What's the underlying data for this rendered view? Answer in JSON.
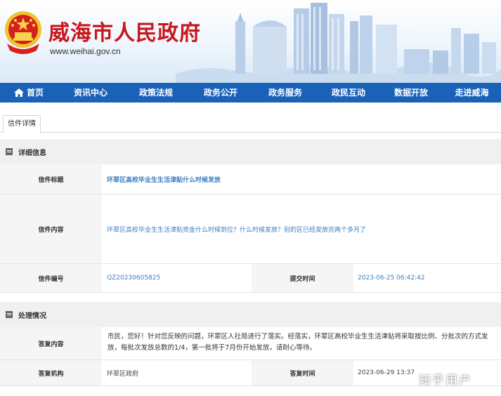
{
  "header": {
    "title": "威海市人民政府",
    "url": "www.weihai.gov.cn",
    "emblem_icon": "national-emblem-icon",
    "title_color": "#c8161d"
  },
  "nav": {
    "items": [
      "首页",
      "资讯中心",
      "政策法规",
      "政务公开",
      "政务服务",
      "政民互动",
      "数据开放",
      "走进威海"
    ],
    "home_icon": "home-icon",
    "bg_color": "#1a62b8"
  },
  "tab": {
    "label": "信件详情"
  },
  "detail": {
    "section_title": "详细信息",
    "title_label": "信件标题",
    "title_value": "环翠区高校毕业生生活津贴什么时候发放",
    "content_label": "信件内容",
    "content_value": "环翠区高校毕业生生活津贴资金什么时候到位？什么时候发放？别的区已经发放完两个多月了",
    "number_label": "信件编号",
    "number_value": "QZ20230605825",
    "submit_label": "提交时间",
    "submit_value": "2023-06-25 06:42:42"
  },
  "handling": {
    "section_title": "处理情况",
    "reply_label": "答复内容",
    "reply_value": "市民，您好！针对您反映的问题，环翠区人社局进行了落实。经落实，环翠区高校毕业生生活津贴将采取按比例、分批次的方式发放，每批次发放总数的1/4，第一批将于7月份开始发放，请耐心等待。",
    "org_label": "答复机构",
    "org_value": "环翠区政府",
    "time_label": "答复时间",
    "time_value": "2023-06-29 13:37"
  },
  "watermark": "知乎用户"
}
